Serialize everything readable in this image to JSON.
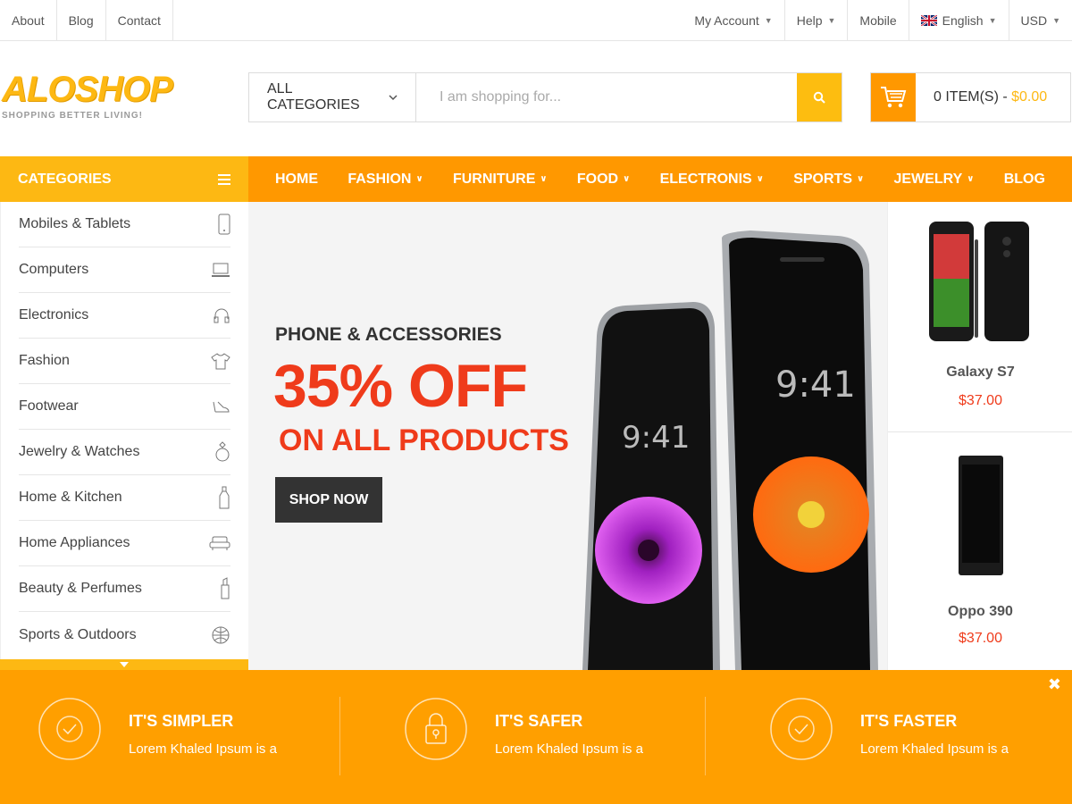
{
  "topbar": {
    "left_links": [
      "About",
      "Blog",
      "Contact"
    ],
    "account": "My Account",
    "help": "Help",
    "mobile": "Mobile",
    "language": "English",
    "currency": "USD"
  },
  "logo": {
    "name": "ALOSHOP",
    "tagline": "SHOPPING BETTER LIVING!"
  },
  "search": {
    "category": "ALL CATEGORIES",
    "placeholder": "I am shopping for..."
  },
  "cart": {
    "items": "0 ITEM(S) - ",
    "total": "$0.00"
  },
  "categories": {
    "title": "CATEGORIES",
    "items": [
      {
        "label": "Mobiles & Tablets",
        "icon": "mobile-icon"
      },
      {
        "label": "Computers",
        "icon": "laptop-icon"
      },
      {
        "label": "Electronics",
        "icon": "headphones-icon"
      },
      {
        "label": "Fashion",
        "icon": "tshirt-icon"
      },
      {
        "label": "Footwear",
        "icon": "shoe-icon"
      },
      {
        "label": "Jewelry & Watches",
        "icon": "ring-icon"
      },
      {
        "label": "Home & Kitchen",
        "icon": "bottle-icon"
      },
      {
        "label": "Home Appliances",
        "icon": "sofa-icon"
      },
      {
        "label": "Beauty & Perfumes",
        "icon": "lipstick-icon"
      },
      {
        "label": "Sports & Outdoors",
        "icon": "ball-icon"
      }
    ]
  },
  "nav": {
    "items": [
      {
        "label": "HOME",
        "dropdown": false
      },
      {
        "label": "FASHION",
        "dropdown": true
      },
      {
        "label": "FURNITURE",
        "dropdown": true
      },
      {
        "label": "FOOD",
        "dropdown": true
      },
      {
        "label": "ELECTRONIS",
        "dropdown": true
      },
      {
        "label": "SPORTS",
        "dropdown": true
      },
      {
        "label": "JEWELRY",
        "dropdown": true
      },
      {
        "label": "BLOG",
        "dropdown": false
      }
    ]
  },
  "hero": {
    "subtitle": "PHONE & ACCESSORIES",
    "headline": "35% OFF",
    "tagline": "ON ALL PRODUCTS",
    "button": "SHOP NOW",
    "phone_time": "9:41"
  },
  "side_products": [
    {
      "name": "Galaxy S7",
      "price": "$37.00"
    },
    {
      "name": "Oppo 390",
      "price": "$37.00"
    }
  ],
  "features": [
    {
      "title": "IT'S SIMPLER",
      "text": "Lorem Khaled Ipsum is a",
      "icon": "check-circle-icon"
    },
    {
      "title": "IT'S SAFER",
      "text": "Lorem Khaled Ipsum is a",
      "icon": "lock-icon"
    },
    {
      "title": "IT'S FASTER",
      "text": "Lorem Khaled Ipsum is a",
      "icon": "check-circle-icon"
    }
  ],
  "colors": {
    "accent_yellow": "#fdb813",
    "accent_orange": "#ff9800",
    "sale_red": "#ef3b1b",
    "band_orange": "#ff9f00"
  }
}
